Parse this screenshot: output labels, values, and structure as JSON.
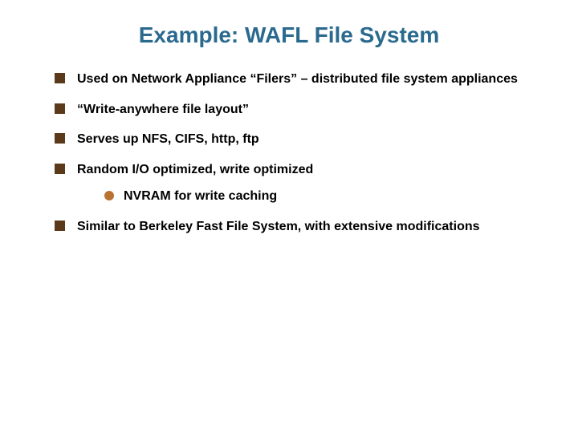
{
  "title": "Example: WAFL File System",
  "bullets": {
    "b0": "Used on Network Appliance “Filers” – distributed file system appliances",
    "b1": "“Write-anywhere file layout”",
    "b2": "Serves up NFS, CIFS, http, ftp",
    "b3": "Random I/O optimized, write optimized",
    "b3_sub0": "NVRAM for write caching",
    "b4": "Similar to Berkeley Fast File System, with extensive modifications"
  }
}
